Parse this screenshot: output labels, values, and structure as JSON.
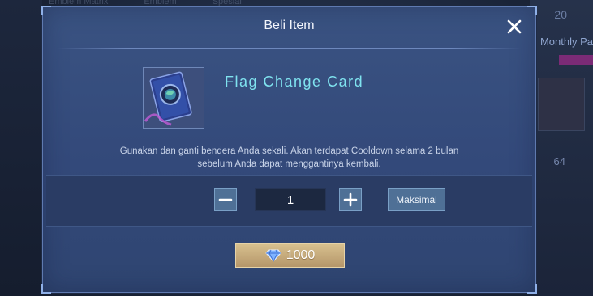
{
  "background": {
    "tabs": [
      "Emblem Matrix",
      "Emblem",
      "Spesial"
    ],
    "right_num_top": "20",
    "right_label": "Monthly Pa",
    "right_num_bottom": "64"
  },
  "dialog": {
    "title": "Beli Item",
    "close_icon": "close-icon",
    "item": {
      "name": "Flag Change Card",
      "icon": "flag-change-card-icon"
    },
    "description_line1": "Gunakan dan ganti bendera Anda sekali. Akan terdapat Cooldown selama 2 bulan",
    "description_line2": "sebelum Anda dapat menggantinya kembali.",
    "quantity": {
      "value": "1",
      "minus_icon": "minus-icon",
      "plus_icon": "plus-icon",
      "max_label": "Maksimal"
    },
    "buy": {
      "currency_icon": "diamond-icon",
      "price": "1000"
    }
  },
  "colors": {
    "dialog_bg": "#3a5382",
    "item_name": "#7fe3ef",
    "button_bg": "#4f7096",
    "buy_gold": "#c9ae7c"
  }
}
